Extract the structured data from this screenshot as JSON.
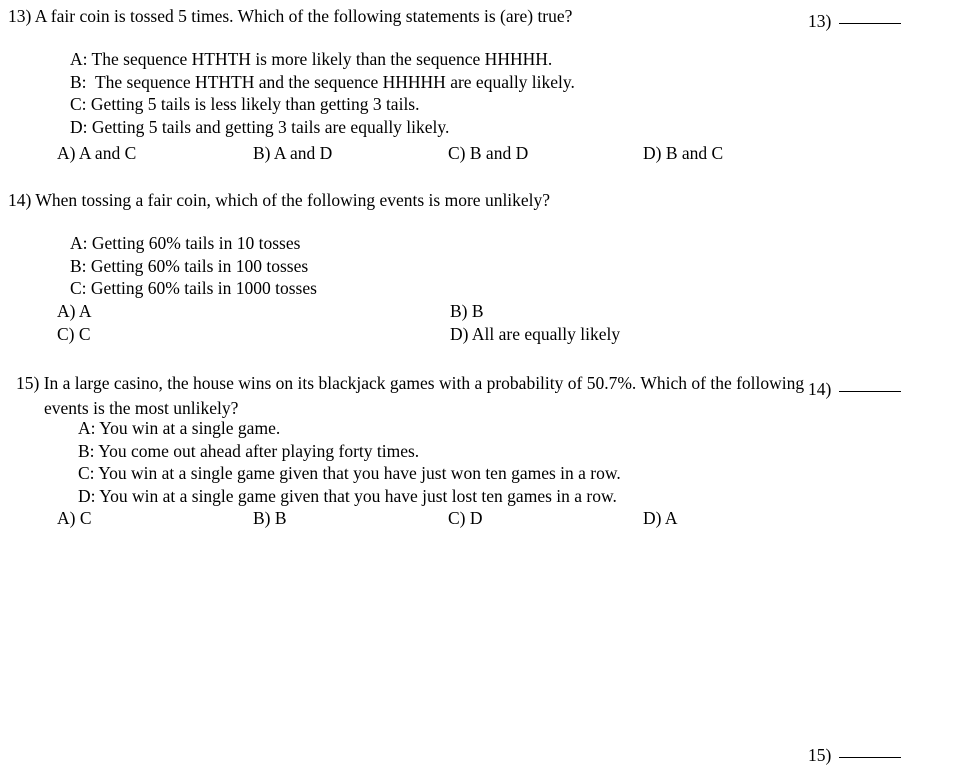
{
  "page": {
    "background_color": "#ffffff",
    "text_color": "#000000"
  },
  "questions": [
    {
      "number_label": "13)",
      "blank_label": "13)",
      "stem": "A fair coin is tossed 5 times. Which of the following statements is (are) true?",
      "statements": [
        "A: The sequence HTHTH is more likely than the sequence HHHHH.",
        "B:  The sequence HTHTH and the sequence HHHHH are equally likely.",
        "C: Getting 5 tails is less likely than getting 3 tails.",
        "D: Getting 5 tails and getting 3 tails are equally likely."
      ],
      "options": [
        "A) A and C",
        "B) A and D",
        "C) B and D",
        "D) B and C"
      ],
      "options_layout": "four-columns"
    },
    {
      "number_label": "14)",
      "blank_label": "14)",
      "stem": "When tossing a fair coin, which of the following events is more unlikely?",
      "statements": [
        "A: Getting 60% tails in 10 tosses",
        "B: Getting 60% tails in 100 tosses",
        "C: Getting 60% tails in 1000 tosses"
      ],
      "options": [
        "A) A",
        "B) B",
        "C) C",
        "D) All are equally likely"
      ],
      "options_layout": "two-by-two"
    },
    {
      "number_label": "15)",
      "blank_label": "15)",
      "stem": "In a large casino, the house wins on its blackjack games with a probability of 50.7%. Which of the following events is the most unlikely?",
      "statements": [
        "A: You win at a single game.",
        "B: You come out ahead after playing forty times.",
        "C: You win at a single game given that you have just won ten games in a row.",
        "D: You win at a single game given that you have just lost ten games in a row."
      ],
      "options": [
        "A) C",
        "B) B",
        "C) D",
        "D) A"
      ],
      "options_layout": "four-columns"
    }
  ]
}
